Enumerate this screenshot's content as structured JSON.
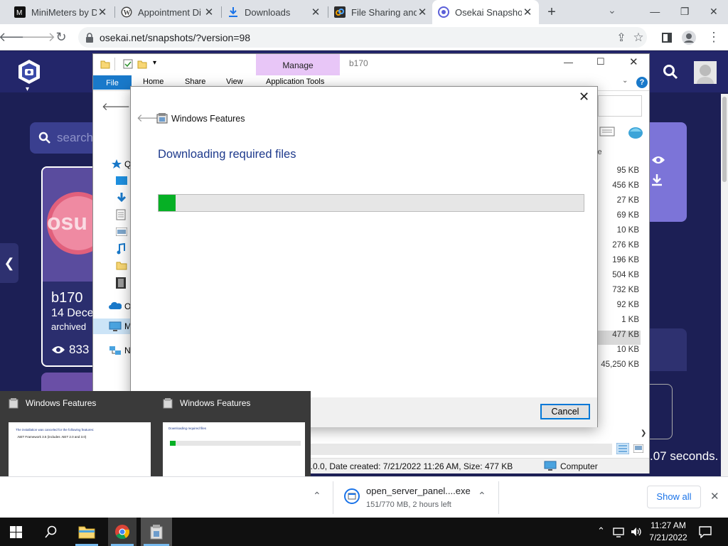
{
  "browser": {
    "tabs": [
      {
        "title": "MiniMeters by D",
        "icon": "minimeters-favicon",
        "active": false
      },
      {
        "title": "Appointment Di",
        "icon": "wordpress-favicon",
        "active": false
      },
      {
        "title": "Downloads",
        "icon": "download-favicon",
        "active": false
      },
      {
        "title": "File Sharing and",
        "icon": "filesharing-favicon",
        "active": false
      },
      {
        "title": "Osekai Snapsho",
        "icon": "osekai-favicon",
        "active": true
      }
    ],
    "new_tab": "+",
    "url": "osekai.net/snapshots/?version=98"
  },
  "site": {
    "search_placeholder": "search",
    "card_title": "b170",
    "card_date": "14 Dece",
    "card_status": "archived",
    "card_views": "833",
    "thumb_text": "osu",
    "seconds_text": ".07 seconds."
  },
  "explorer": {
    "title": "b170",
    "manage_label": "Manage",
    "ribbon_tabs": [
      "File",
      "Home",
      "Share",
      "View",
      "Application Tools"
    ],
    "size_header": "ze",
    "nav_letters": [
      "Q",
      "O",
      "M",
      "N"
    ],
    "sizes": [
      "95 KB",
      "456 KB",
      "27 KB",
      "69 KB",
      "10 KB",
      "276 KB",
      "196 KB",
      "504 KB",
      "732 KB",
      "92 KB",
      "1 KB",
      "477 KB",
      "10 KB",
      "45,250 KB"
    ],
    "status_detail": "0.0.0, Date created: 7/21/2022 11:26 AM, Size:  477 KB",
    "status_location": "Computer",
    "left_status_fragments": [
      "it",
      "os"
    ]
  },
  "dialog": {
    "title": "Windows Features",
    "heading": "Downloading required files",
    "progress_percent": 4,
    "cancel_label": "Cancel"
  },
  "previews": [
    {
      "title": "Windows Features",
      "line1": "The installation was canceled for the following features:",
      "line2": ".NET Framework 3.5 (includes .NET 2.0 and 3.0)",
      "button": "Close"
    },
    {
      "title": "Windows Features",
      "line1": "Downloading required files",
      "button": "Cancel"
    }
  ],
  "download": {
    "filename": "open_server_panel....exe",
    "progress": "151/770 MB, 2 hours left",
    "show_all": "Show all"
  },
  "taskbar": {
    "time": "11:27 AM",
    "date": "7/21/2022"
  },
  "colors": {
    "accent_blue": "#1a73e8",
    "progress_green": "#06b025",
    "manage_tab_bg": "#e8c6f7",
    "site_bg": "#1c1f55",
    "card_purple": "#5a4c9e"
  }
}
